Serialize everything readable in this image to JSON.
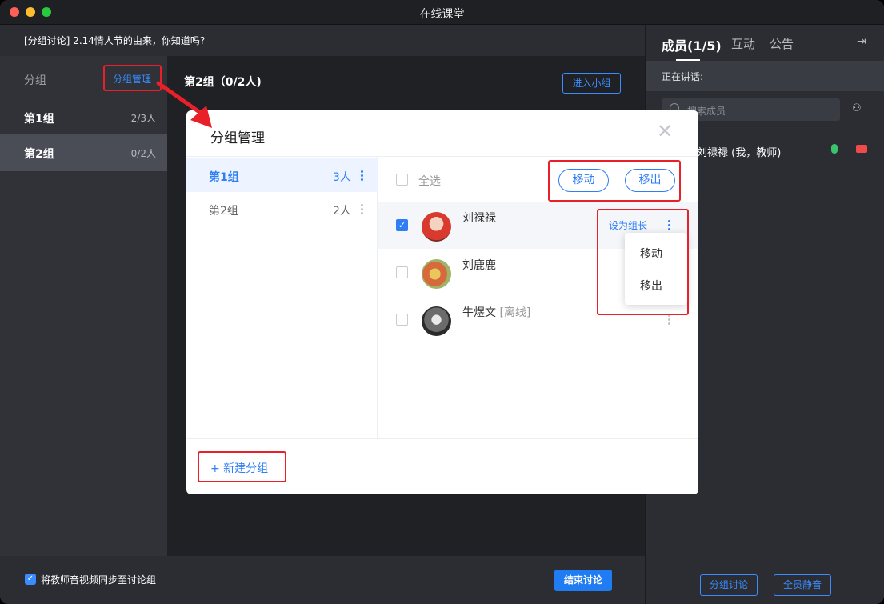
{
  "window": {
    "title": "在线课堂"
  },
  "topic": {
    "text": "[分组讨论] 2.14情人节的由来，你知道吗?"
  },
  "groups": {
    "header": "分组",
    "manage_label": "分组管理",
    "items": [
      {
        "name": "第1组",
        "count": "2/3人"
      },
      {
        "name": "第2组",
        "count": "0/2人"
      }
    ]
  },
  "main": {
    "group_title": "第2组（0/2人)",
    "enter_label": "进入小组"
  },
  "bottom": {
    "sync_label": "将教师音视频同步至讨论组",
    "end_label": "结束讨论"
  },
  "sidebar": {
    "tabs": [
      "成员(1/5)",
      "互动",
      "公告"
    ],
    "speaking": "正在讲话:",
    "search_placeholder": "搜索成员",
    "member": "刘禄禄 (我，教师)",
    "buttons": [
      "分组讨论",
      "全员静音"
    ]
  },
  "modal": {
    "title": "分组管理",
    "groups": [
      {
        "name": "第1组",
        "count": "3人"
      },
      {
        "name": "第2组",
        "count": "2人"
      }
    ],
    "select_all": "全选",
    "move_label": "移动",
    "remove_label": "移出",
    "members": [
      {
        "name": "刘禄禄",
        "status": "",
        "checked": true
      },
      {
        "name": "刘鹿鹿",
        "status": "",
        "checked": false
      },
      {
        "name": "牛煜文",
        "status": "[离线]",
        "checked": false
      }
    ],
    "set_leader": "设为组长",
    "menu": [
      "移动",
      "移出"
    ],
    "new_group": "+ 新建分组"
  },
  "colors": {
    "accent": "#2f7ef6",
    "highlight": "#e8202a"
  }
}
